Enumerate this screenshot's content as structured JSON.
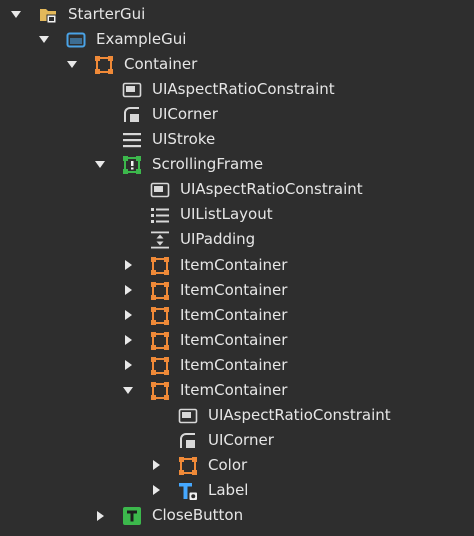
{
  "tree": {
    "rows": [
      {
        "label": "StarterGui",
        "icon": "startergui-folder-icon",
        "depth": 0,
        "expander": "expanded"
      },
      {
        "label": "ExampleGui",
        "icon": "screengui-icon",
        "depth": 1,
        "expander": "expanded"
      },
      {
        "label": "Container",
        "icon": "frame-icon",
        "depth": 2,
        "expander": "expanded"
      },
      {
        "label": "UIAspectRatioConstraint",
        "icon": "aspect-ratio-icon",
        "depth": 3,
        "expander": "none"
      },
      {
        "label": "UICorner",
        "icon": "corner-icon",
        "depth": 3,
        "expander": "none"
      },
      {
        "label": "UIStroke",
        "icon": "stroke-icon",
        "depth": 3,
        "expander": "none"
      },
      {
        "label": "ScrollingFrame",
        "icon": "scrollingframe-icon",
        "depth": 3,
        "expander": "expanded"
      },
      {
        "label": "UIAspectRatioConstraint",
        "icon": "aspect-ratio-icon",
        "depth": 4,
        "expander": "none"
      },
      {
        "label": "UIListLayout",
        "icon": "list-layout-icon",
        "depth": 4,
        "expander": "none"
      },
      {
        "label": "UIPadding",
        "icon": "padding-icon",
        "depth": 4,
        "expander": "none"
      },
      {
        "label": "ItemContainer",
        "icon": "frame-icon",
        "depth": 4,
        "expander": "collapsed"
      },
      {
        "label": "ItemContainer",
        "icon": "frame-icon",
        "depth": 4,
        "expander": "collapsed"
      },
      {
        "label": "ItemContainer",
        "icon": "frame-icon",
        "depth": 4,
        "expander": "collapsed"
      },
      {
        "label": "ItemContainer",
        "icon": "frame-icon",
        "depth": 4,
        "expander": "collapsed"
      },
      {
        "label": "ItemContainer",
        "icon": "frame-icon",
        "depth": 4,
        "expander": "collapsed"
      },
      {
        "label": "ItemContainer",
        "icon": "frame-icon",
        "depth": 4,
        "expander": "expanded"
      },
      {
        "label": "UIAspectRatioConstraint",
        "icon": "aspect-ratio-icon",
        "depth": 5,
        "expander": "none"
      },
      {
        "label": "UICorner",
        "icon": "corner-icon",
        "depth": 5,
        "expander": "none"
      },
      {
        "label": "Color",
        "icon": "frame-icon",
        "depth": 5,
        "expander": "collapsed"
      },
      {
        "label": "Label",
        "icon": "textlabel-icon",
        "depth": 5,
        "expander": "collapsed"
      },
      {
        "label": "CloseButton",
        "icon": "textbutton-icon",
        "depth": 3,
        "expander": "collapsed"
      }
    ]
  },
  "colors": {
    "background": "#2e2e2e",
    "text": "#e6e6e6",
    "frame": "#f08a38",
    "scrolling": "#3cb84c",
    "screengui": "#4aa3e6",
    "folder": "#e3b85a",
    "textlabel": "#45a8ff",
    "constraint": "#d8d8d8"
  }
}
